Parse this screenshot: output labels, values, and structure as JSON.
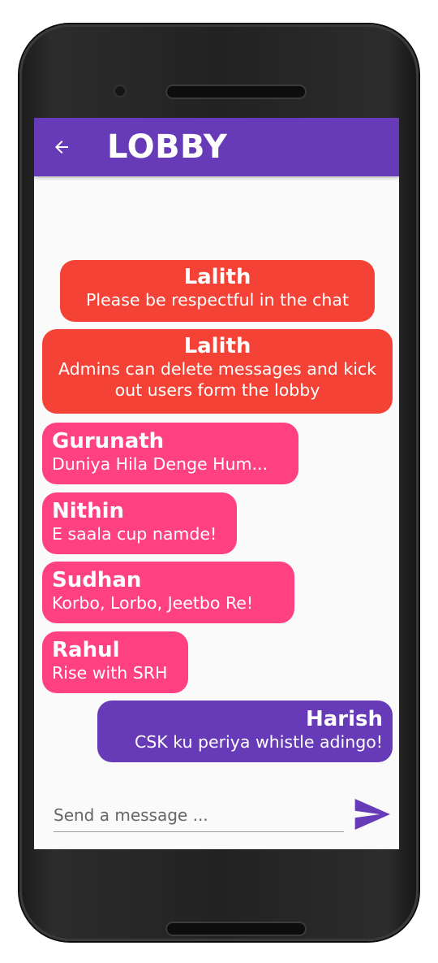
{
  "app": {
    "title": "LOBBY",
    "accent_color": "#673ab7",
    "admin_color": "#f44336",
    "user_color": "#ff4081"
  },
  "messages": [
    {
      "sender": "Lalith",
      "text": "Please be respectful in the chat",
      "kind": "admin"
    },
    {
      "sender": "Lalith",
      "text": "Admins can delete messages and kick out users form the lobby",
      "kind": "admin"
    },
    {
      "sender": "Gurunath",
      "text": "Duniya Hila Denge Hum...",
      "kind": "user"
    },
    {
      "sender": "Nithin",
      "text": "E saala cup namde!",
      "kind": "user"
    },
    {
      "sender": "Sudhan",
      "text": "Korbo, Lorbo, Jeetbo Re!",
      "kind": "user"
    },
    {
      "sender": "Rahul",
      "text": "Rise with SRH",
      "kind": "user"
    },
    {
      "sender": "Harish",
      "text": "CSK ku periya whistle adingo!",
      "kind": "self"
    }
  ],
  "composer": {
    "placeholder": "Send a message ...",
    "value": "",
    "send_icon": "send-icon"
  },
  "icons": {
    "back": "arrow-back-icon",
    "send": "send-icon"
  }
}
